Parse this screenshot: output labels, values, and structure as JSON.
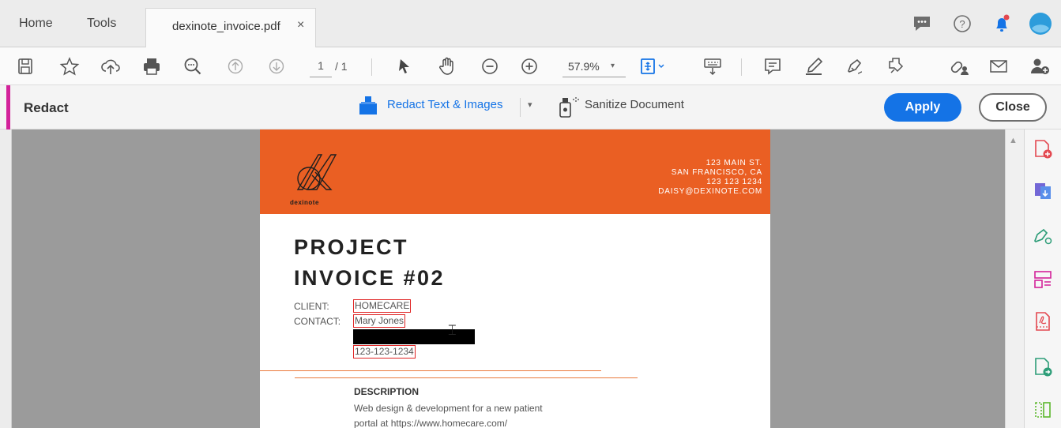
{
  "tabs": {
    "home": "Home",
    "tools": "Tools",
    "document": "dexinote_invoice.pdf",
    "close_glyph": "×"
  },
  "toolbar": {
    "page_current": "1",
    "page_total": "/ 1",
    "zoom": "57.9%",
    "zoom_caret": "▾"
  },
  "redact": {
    "title": "Redact",
    "redact_text_images": "Redact Text & Images",
    "dropdown_caret": "▾",
    "sanitize": "Sanitize Document",
    "apply": "Apply",
    "close": "Close"
  },
  "invoice": {
    "logo_word": "dexinote",
    "address": [
      "123 MAIN ST.",
      "SAN FRANCISCO, CA",
      "123 123 1234",
      "DAISY@DEXINOTE.COM"
    ],
    "title_line1": "PROJECT",
    "title_line2": "INVOICE #02",
    "client_label": "CLIENT:",
    "client_value": "HOMECARE",
    "contact_label": "CONTACT:",
    "contact_value": "Mary Jones",
    "phone_value": "123-123-1234",
    "description_heading": "DESCRIPTION",
    "description_line1": "Web design & development for a new patient",
    "description_line2": "portal at https://www.homecare.com/"
  },
  "colors": {
    "accent_blue": "#1473e6",
    "invoice_orange": "#ea5f23",
    "redact_accent": "#d3229a",
    "redaction_mark": "#e02424"
  }
}
